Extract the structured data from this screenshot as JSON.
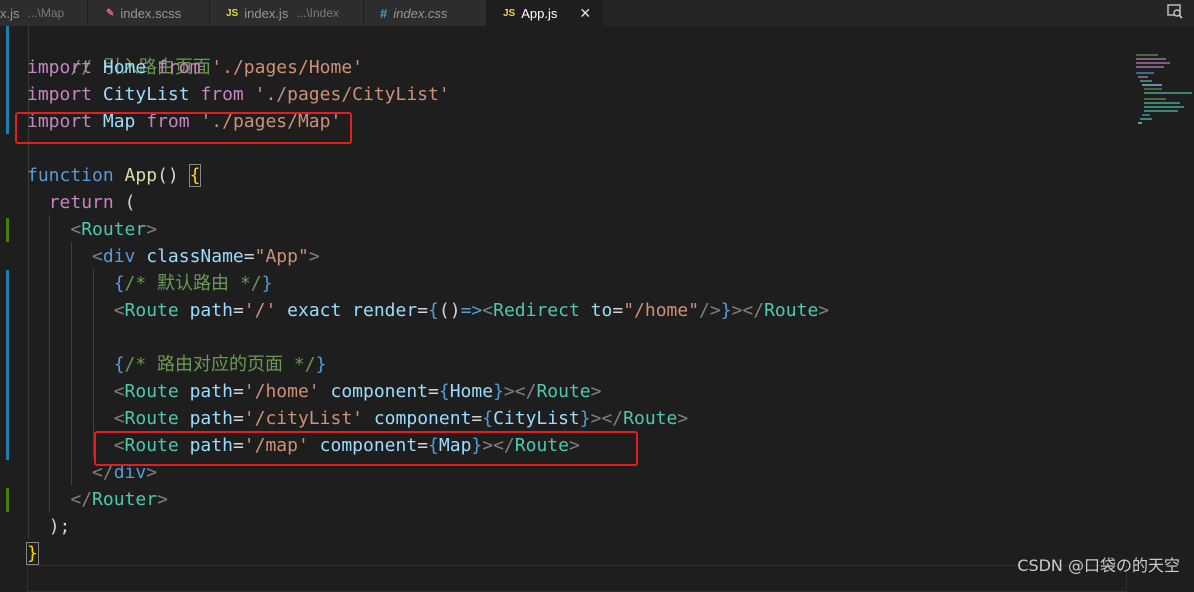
{
  "tabs": [
    {
      "icon": "",
      "label": "x.js",
      "desc": "...\\Map"
    },
    {
      "icon": "scss-icon",
      "label": "index.scss",
      "desc": ""
    },
    {
      "icon": "JS",
      "label": "index.js",
      "desc": "...\\Index"
    },
    {
      "icon": "#",
      "label": "index.css",
      "desc": ""
    },
    {
      "icon": "JS",
      "label": "App.js",
      "desc": "",
      "active": true
    }
  ],
  "tab_icon_scss": "✎",
  "close_glyph": "✕",
  "code": {
    "l1": "// 引入路由页面",
    "import_kw": "import",
    "from_kw": "from",
    "home_id": "Home",
    "home_path": "'./pages/Home'",
    "citylist_id": "CityList",
    "citylist_path": "'./pages/CityList'",
    "map_id": "Map",
    "map_path": "'./pages/Map'",
    "function_kw": "function",
    "app_fn": "App",
    "return_kw": "return",
    "router": "Router",
    "div": "div",
    "classname_attr": "className",
    "app_str": "\"App\"",
    "cmt_default": "/* 默认路由 */",
    "route": "Route",
    "path_attr": "path",
    "root_path": "'/'",
    "exact_attr": "exact",
    "render_attr": "render",
    "redirect": "Redirect",
    "to_attr": "to",
    "home_str": "\"/home\"",
    "cmt_pages": "/* 路由对应的页面 */",
    "home_route_path": "'/home'",
    "component_attr": "component",
    "citylist_route_path": "'/cityList'",
    "map_route_path": "'/map'"
  },
  "watermark": "CSDN @口袋の的天空",
  "colors": {
    "annotation_box": "#e02020",
    "background": "#1e1e1e",
    "keyword": "#569cd6",
    "identifier": "#9cdcfe",
    "string": "#ce9178",
    "comment": "#6a9955",
    "jsx_tag": "#4ec9b0"
  }
}
